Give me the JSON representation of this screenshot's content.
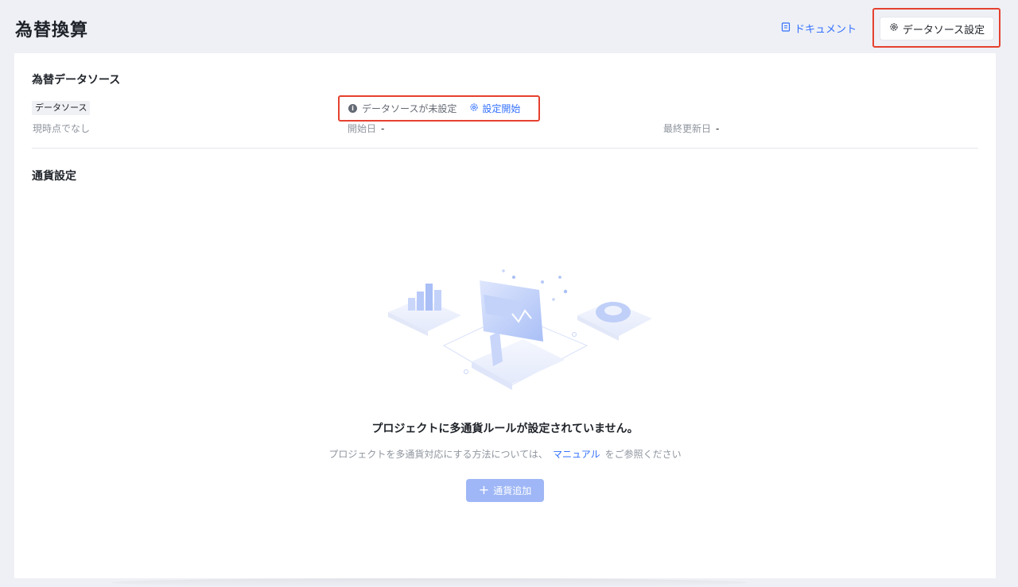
{
  "header": {
    "title": "為替換算",
    "doc_link_label": "ドキュメント",
    "datasource_settings_label": "データソース設定"
  },
  "datasource_section": {
    "title": "為替データソース",
    "tag": "データソース",
    "status": "現時点でなし",
    "unset_text": "データソースが未設定",
    "setup_link_label": "設定開始",
    "start_date_label": "開始日",
    "start_date_value": "-",
    "last_updated_label": "最終更新日",
    "last_updated_value": "-"
  },
  "currency_section": {
    "title": "通貨設定",
    "empty_title": "プロジェクトに多通貨ルールが設定されていません。",
    "empty_desc_before": "プロジェクトを多通貨対応にする方法については、",
    "manual_link": "マニュアル",
    "empty_desc_after": "をご参照ください",
    "add_button_label": "通貨追加"
  },
  "icons": {
    "doc": "document-icon",
    "gear": "gear-icon",
    "info": "info-icon",
    "plus": "plus-icon"
  },
  "colors": {
    "accent": "#3370ff",
    "highlight": "#e5412f",
    "disabled_button": "#9fb7f6"
  }
}
